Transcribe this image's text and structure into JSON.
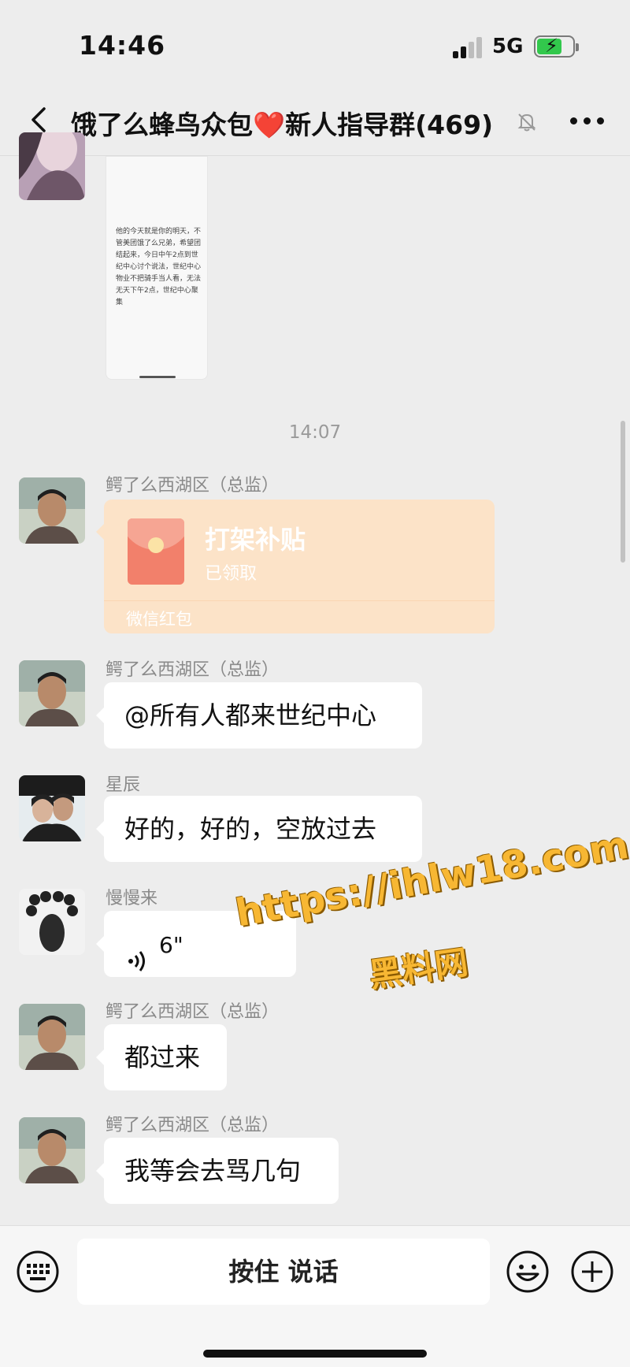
{
  "status_bar": {
    "time": "14:46",
    "network": "5G",
    "battery_level": 0.7,
    "battery_charging": true
  },
  "header": {
    "title_prefix": "饿了么蜂鸟众包",
    "title_heart": "❤️",
    "title_suffix": "新人指导群",
    "member_count": "(469)",
    "icons": [
      "back-chevron-icon",
      "mute-bell-icon",
      "more-dots-icon"
    ]
  },
  "image_message": {
    "text": "他的今天就是你的明天，不管美团饿了么兄弟，希望团结起来，今日中午2点到世纪中心讨个说法，世纪中心物业不把骑手当人看，无法无天下午2点，世纪中心聚集"
  },
  "time_separator": "14:07",
  "messages": [
    {
      "sender": "鳄了么西湖区（总监）",
      "type": "red_packet",
      "packet_title": "打架补贴",
      "packet_status": "已领取",
      "packet_footer": "微信红包"
    },
    {
      "sender": "鳄了么西湖区（总监）",
      "type": "text",
      "text": "@所有人都来世纪中心"
    },
    {
      "sender": "星辰",
      "type": "text",
      "text": "好的，好的，空放过去"
    },
    {
      "sender": "慢慢来",
      "type": "voice",
      "duration": "6\""
    },
    {
      "sender": "鳄了么西湖区（总监）",
      "type": "text",
      "text": "都过来"
    },
    {
      "sender": "鳄了么西湖区（总监）",
      "type": "text",
      "text": "我等会去骂几句"
    }
  ],
  "watermark": {
    "url": "https://ihlw18.com",
    "label": "黑料网"
  },
  "input_bar": {
    "hold_to_talk": "按住 说话",
    "icons": [
      "keyboard-icon",
      "emoji-icon",
      "plus-icon"
    ]
  }
}
